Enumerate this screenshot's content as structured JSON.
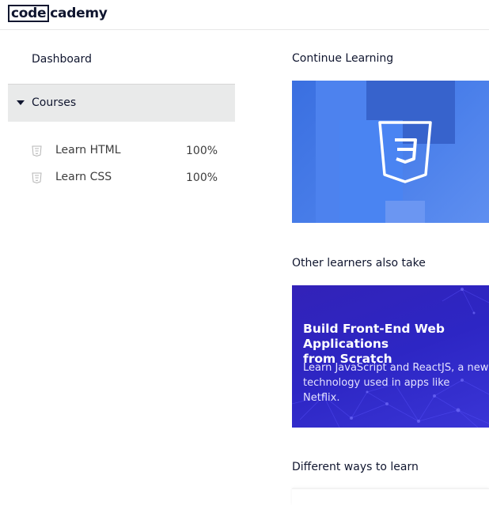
{
  "header": {
    "logo_part1": "code",
    "logo_part2": "cademy"
  },
  "sidebar": {
    "dashboard_label": "Dashboard",
    "courses_label": "Courses",
    "courses": [
      {
        "name": "Learn HTML",
        "progress": "100%",
        "icon": "html5-icon"
      },
      {
        "name": "Learn CSS",
        "progress": "100%",
        "icon": "css3-icon"
      }
    ]
  },
  "main": {
    "continue_title": "Continue Learning",
    "continue_card_icon": "css3-icon",
    "other_title": "Other learners also take",
    "promo": {
      "title": "Build Front-End Web Applications\nfrom Scratch",
      "description": "Learn JavaScript and ReactJS, a new\ntechnology used in apps like Netflix."
    },
    "ways_title": "Different ways to learn"
  },
  "colors": {
    "brand_dark": "#10162f",
    "css_blue": "#3a6fe0",
    "promo_purple": "#2d26c4"
  }
}
